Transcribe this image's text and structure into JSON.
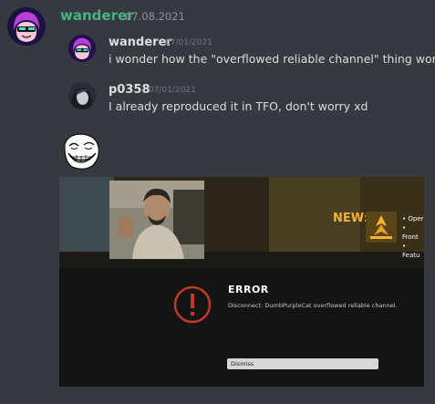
{
  "message": {
    "author": "wanderer",
    "timestamp": "07.08.2021",
    "author_color": "#43b581"
  },
  "quotes": [
    {
      "author": "wanderer",
      "timestamp": "07/01/2021",
      "text": "i wonder how the \"overflowed reliable channel\" thing works"
    },
    {
      "author": "p0358",
      "timestamp": "07/01/2021",
      "text": "I already reproduced it in TFO, don't worry xd"
    }
  ],
  "embed": {
    "new_label": "NEW:",
    "bullets": [
      "Oper",
      "Front",
      "Featu"
    ],
    "error_title": "ERROR",
    "error_message": "Disconnect: DumbPurpleCat overflowed reliable channel.",
    "dismiss_label": "Dismiss"
  },
  "colors": {
    "background": "#36393f",
    "error_red": "#c0392b",
    "accent_gold": "#f2b233"
  }
}
